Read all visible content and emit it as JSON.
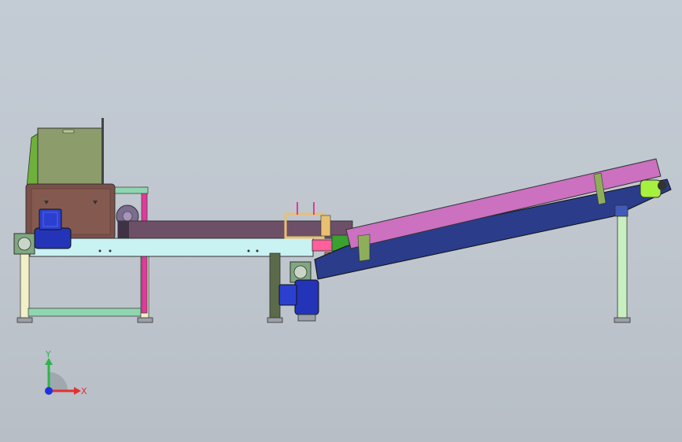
{
  "viewport": {
    "background_top": "#c3cbd4",
    "background_bottom": "#b7bec6"
  },
  "triad": {
    "x_label": "X",
    "y_label": "Y",
    "x_color": "#e23030",
    "y_color": "#2fb34a",
    "z_color": "#2030e0"
  },
  "parts": {
    "hopper": "#8c9c6a",
    "crusher_body": "#7a5048",
    "feed_channel": "#6e4f68",
    "main_frame_beam": "#c9f2f2",
    "support_frame": "#8fd6b0",
    "support_leg": "#f2f0c6",
    "incline_belt_top": "#cc70c0",
    "incline_belt_frame": "#2a3c8a",
    "magenta_post": "#e03a9a",
    "motor": "#2434b8",
    "transfer_guide": "#e8c070",
    "transfer_chute": "#ff5f9a",
    "green_bracket": "#3aa030",
    "orange_bracket": "#f07a20",
    "lime_pulley": "#a6f040"
  }
}
